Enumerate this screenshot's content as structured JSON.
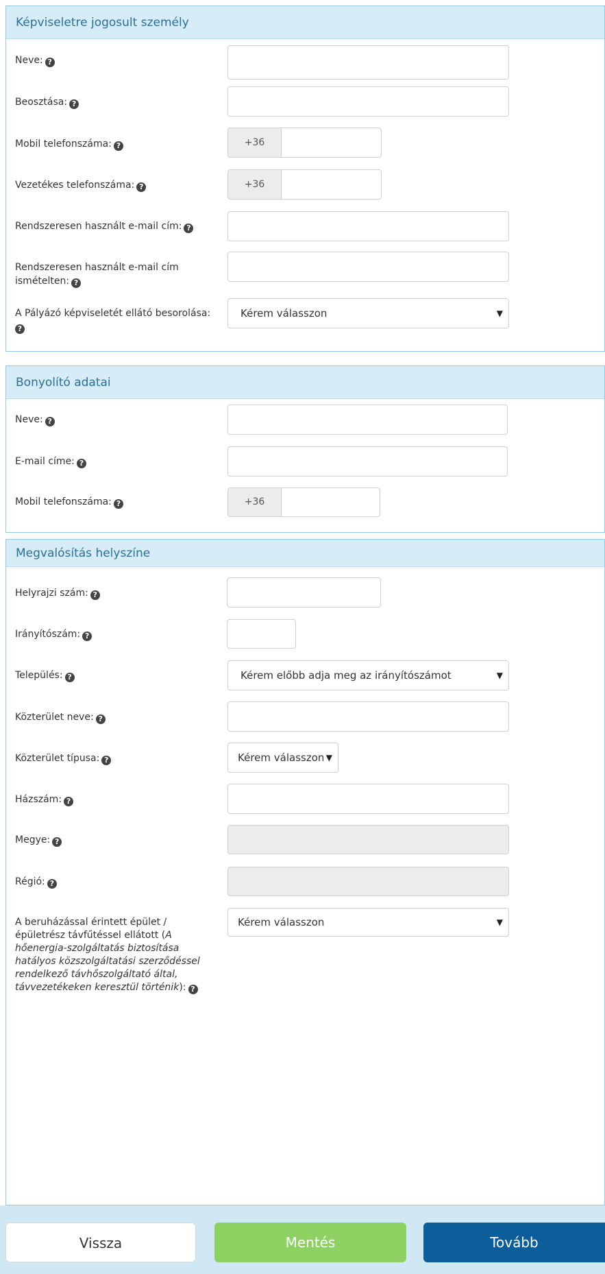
{
  "sections": {
    "representative": {
      "title": "Képviseletre jogosult személy",
      "name_label": "Neve:",
      "position_label": "Beosztása:",
      "mobile_label": "Mobil telefonszáma:",
      "mobile_prefix": "+36",
      "landline_label": "Vezetékes telefonszáma:",
      "landline_prefix": "+36",
      "email_label": "Rendszeresen használt e-mail cím:",
      "email_repeat_label": "Rendszeresen használt e-mail cím ismételten:",
      "classification_label": "A Pályázó képviseletét ellátó besorolása:",
      "classification_value": "Kérem válasszon"
    },
    "contractor": {
      "title": "Bonyolító adatai",
      "name_label": "Neve:",
      "email_label": "E-mail címe:",
      "mobile_label": "Mobil telefonszáma:",
      "mobile_prefix": "+36"
    },
    "location": {
      "title": "Megvalósítás helyszíne",
      "lot_label": "Helyrajzi szám:",
      "zip_label": "Irányítószám:",
      "city_label": "Település:",
      "city_value": "Kérem előbb adja meg az irányítószámot",
      "street_name_label": "Közterület neve:",
      "street_type_label": "Közterület típusa:",
      "street_type_value": "Kérem válasszon",
      "house_number_label": "Házszám:",
      "county_label": "Megye:",
      "region_label": "Régió:",
      "heating_label_main": "A beruházással érintett épület / épületrész távfűtéssel ellátott (",
      "heating_label_italic": "A hőenergia-szolgáltatás biztosítása hatályos közszolgáltatási szerződéssel rendelkező távhőszolgáltató által, távvezetékeken keresztül történik",
      "heating_label_end": "):",
      "heating_value": "Kérem válasszon"
    }
  },
  "buttons": {
    "back": "Vissza",
    "save": "Mentés",
    "next": "Tovább"
  },
  "colors": {
    "header_bg": "#d6edf7",
    "header_text": "#2a6f97",
    "save_button": "#8dd163",
    "next_button": "#0b5e9a"
  },
  "icons": {
    "help": "question-circle-icon",
    "dropdown": "caret-down-icon"
  }
}
